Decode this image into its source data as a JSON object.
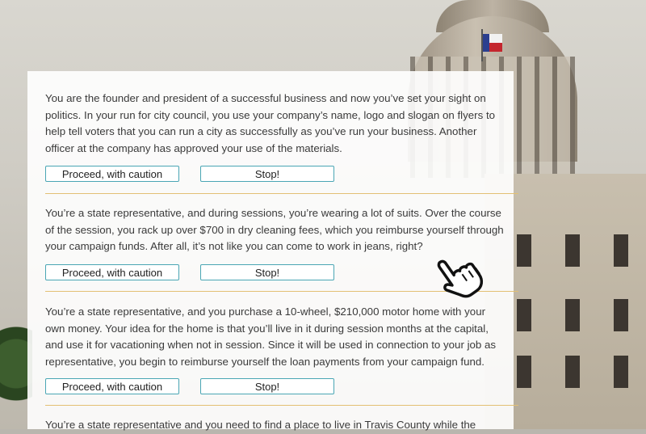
{
  "scenarios": [
    {
      "text": "You are the founder and president of a successful business and now you’ve set your sight on politics. In your run for city council, you use your company’s name, logo and slogan on flyers to help tell voters that you can run a city as successfully as you’ve run your business. Another officer at the company has approved your use of the materials.",
      "proceed_label": "Proceed, with caution",
      "stop_label": "Stop!"
    },
    {
      "text": "You’re a state representative, and during sessions, you’re wearing a lot of suits. Over the course of the session, you rack up over $700 in dry cleaning fees, which you reimburse yourself through your campaign funds. After all, it’s not like you can come to work in jeans, right?",
      "proceed_label": "Proceed, with caution",
      "stop_label": "Stop!"
    },
    {
      "text": "You’re a state representative, and you purchase a 10-wheel, $210,000 motor home with your own money. Your idea for the home is that you’ll live in it during session months at the capital, and use it for vacationing when not in session. Since it will be used in connection to your job as representative, you begin to reimburse yourself the loan payments from your campaign fund.",
      "proceed_label": "Proceed, with caution",
      "stop_label": "Stop!"
    },
    {
      "text": "You’re a state representative and you need to find a place to live in Travis County while the"
    }
  ],
  "colors": {
    "button_border": "#4aa6b4",
    "divider": "#e3c074",
    "text": "#3a3a3a"
  },
  "icons": {
    "cursor": "hand-pointer-icon"
  }
}
